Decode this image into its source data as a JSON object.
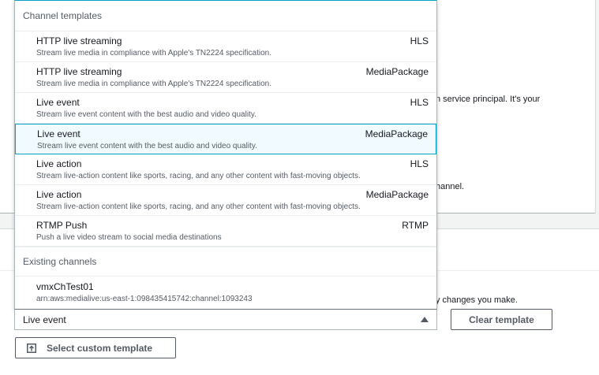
{
  "background": {
    "text_1": "n service principal. It's your",
    "text_2": "hannel.",
    "text_3": "y changes you make."
  },
  "dropdown": {
    "group_templates": "Channel templates",
    "templates": [
      {
        "label": "HTTP live streaming",
        "tag": "HLS",
        "desc": "Stream live media in compliance with Apple's TN2224 specification."
      },
      {
        "label": "HTTP live streaming",
        "tag": "MediaPackage",
        "desc": "Stream live media in compliance with Apple's TN2224 specification."
      },
      {
        "label": "Live event",
        "tag": "HLS",
        "desc": "Stream live event content with the best audio and video quality."
      },
      {
        "label": "Live event",
        "tag": "MediaPackage",
        "desc": "Stream live event content with the best audio and video quality."
      },
      {
        "label": "Live action",
        "tag": "HLS",
        "desc": "Stream live-action content like sports, racing, and any other content with fast-moving objects."
      },
      {
        "label": "Live action",
        "tag": "MediaPackage",
        "desc": "Stream live-action content like sports, racing, and any other content with fast-moving objects."
      },
      {
        "label": "RTMP Push",
        "tag": "RTMP",
        "desc": "Push a live video stream to social media destinations"
      }
    ],
    "group_existing": "Existing channels",
    "existing": [
      {
        "label": "vmxChTest01",
        "desc": "arn:aws:medialive:us-east-1:098435415742:channel:1093243"
      }
    ]
  },
  "select": {
    "value": "Live event"
  },
  "buttons": {
    "clear_template": "Clear template",
    "select_custom_template": "Select custom template"
  },
  "colors": {
    "accent": "#00a1c9",
    "selected_bg": "#f1faff"
  }
}
